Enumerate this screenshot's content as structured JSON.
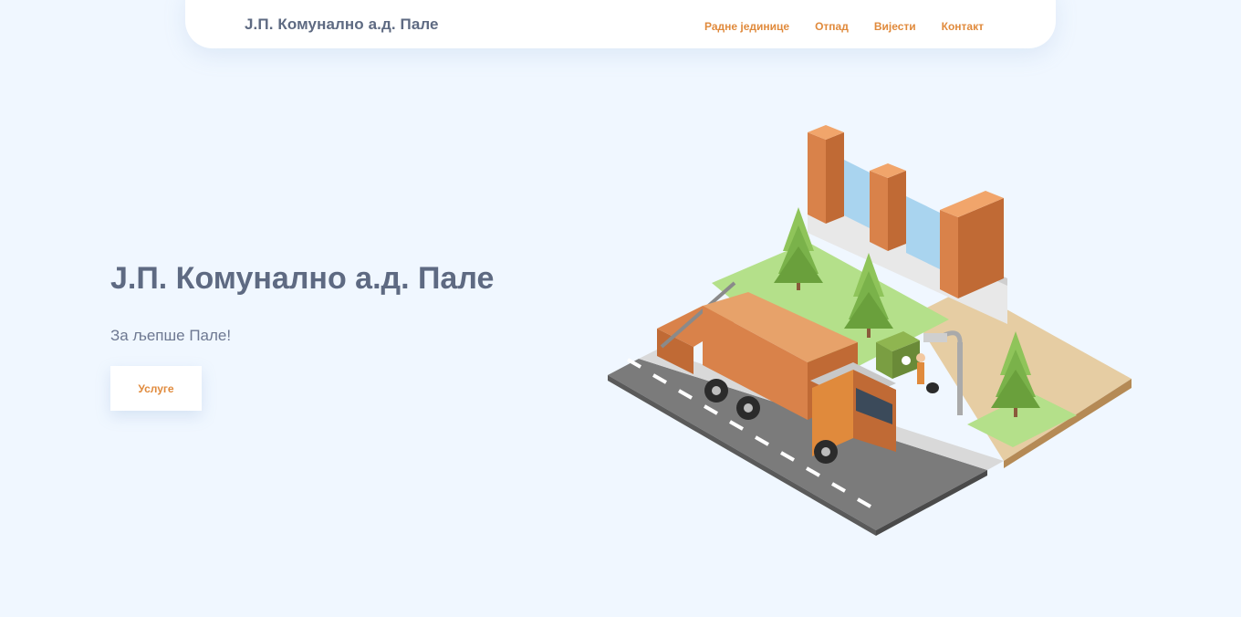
{
  "navbar": {
    "brand": "Ј.П. Комунално а.д. Пале",
    "links": [
      "Радне јединице",
      "Отпад",
      "Вијести",
      "Контакт"
    ]
  },
  "hero": {
    "title": "Ј.П. Комунално а.д. Пале",
    "subtitle": "За љепше Пале!",
    "button_label": "Услуге"
  },
  "colors": {
    "background": "#f0f7ff",
    "accent": "#e08a3c",
    "text": "#5e6a82"
  },
  "icons": [
    "garbage-truck-illustration",
    "recycle-bin-icon"
  ]
}
